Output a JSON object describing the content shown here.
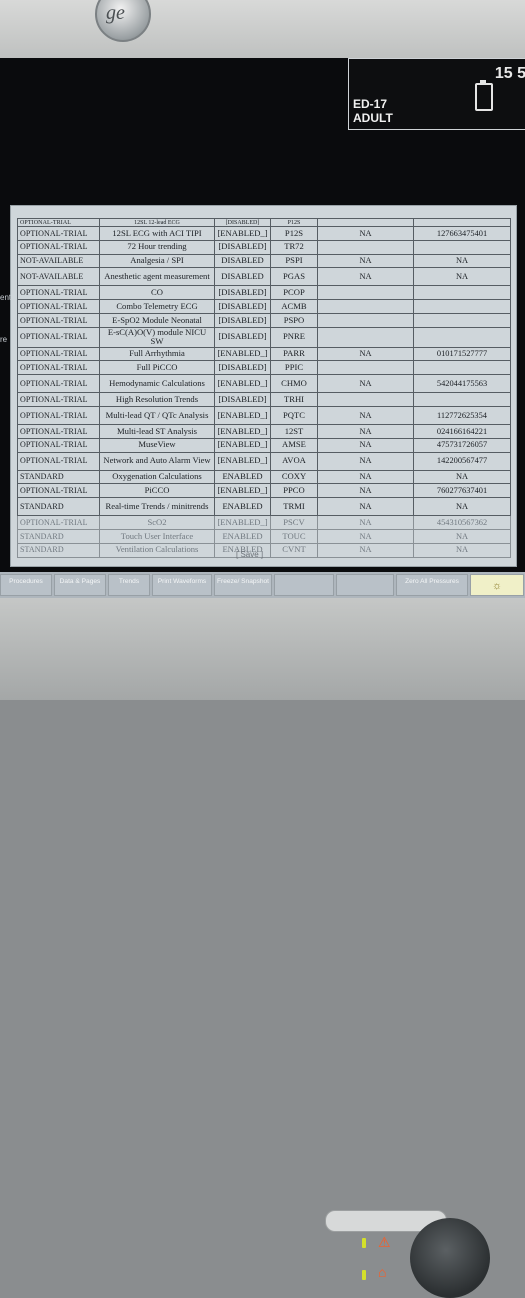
{
  "device": {
    "tile": {
      "number": "15 5",
      "line1": "ED-17",
      "line2": "ADULT"
    }
  },
  "partial_header": {
    "status": "OPTIONAL-TRIAL",
    "option": "12SL 12-lead ECG",
    "state": "[DISABLED]",
    "code": "P12S"
  },
  "left_fragments": [
    "ent",
    "re"
  ],
  "rows": [
    {
      "status": "OPTIONAL-TRIAL",
      "option": "12SL ECG with ACI TIPI",
      "state": "[ENABLED_]",
      "code": "P12S",
      "lic": "NA",
      "key": "127663475401",
      "tall": false,
      "faded": false
    },
    {
      "status": "OPTIONAL-TRIAL",
      "option": "72 Hour trending",
      "state": "[DISABLED]",
      "code": "TR72",
      "lic": "",
      "key": "",
      "tall": false,
      "faded": false
    },
    {
      "status": "NOT-AVAILABLE",
      "option": "Analgesia / SPI",
      "state": "DISABLED",
      "code": "PSPI",
      "lic": "NA",
      "key": "NA",
      "tall": false,
      "faded": false
    },
    {
      "status": "NOT-AVAILABLE",
      "option": "Anesthetic agent measurement",
      "state": "DISABLED",
      "code": "PGAS",
      "lic": "NA",
      "key": "NA",
      "tall": true,
      "faded": false
    },
    {
      "status": "OPTIONAL-TRIAL",
      "option": "CO",
      "state": "[DISABLED]",
      "code": "PCOP",
      "lic": "",
      "key": "",
      "tall": false,
      "faded": false
    },
    {
      "status": "OPTIONAL-TRIAL",
      "option": "Combo Telemetry ECG",
      "state": "[DISABLED]",
      "code": "ACMB",
      "lic": "",
      "key": "",
      "tall": false,
      "faded": false
    },
    {
      "status": "OPTIONAL-TRIAL",
      "option": "E-SpO2 Module Neonatal",
      "state": "[DISABLED]",
      "code": "PSPO",
      "lic": "",
      "key": "",
      "tall": false,
      "faded": false
    },
    {
      "status": "OPTIONAL-TRIAL",
      "option": "E-sC(A)O(V) module NICU SW",
      "state": "[DISABLED]",
      "code": "PNRE",
      "lic": "",
      "key": "",
      "tall": true,
      "faded": false
    },
    {
      "status": "OPTIONAL-TRIAL",
      "option": "Full Arrhythmia",
      "state": "[ENABLED_]",
      "code": "PARR",
      "lic": "NA",
      "key": "010171527777",
      "tall": false,
      "faded": false
    },
    {
      "status": "OPTIONAL-TRIAL",
      "option": "Full PiCCO",
      "state": "[DISABLED]",
      "code": "PPIC",
      "lic": "",
      "key": "",
      "tall": false,
      "faded": false
    },
    {
      "status": "OPTIONAL-TRIAL",
      "option": "Hemodynamic Calculations",
      "state": "[ENABLED_]",
      "code": "CHMO",
      "lic": "NA",
      "key": "542044175563",
      "tall": true,
      "faded": false
    },
    {
      "status": "OPTIONAL-TRIAL",
      "option": "High Resolution Trends",
      "state": "[DISABLED]",
      "code": "TRHI",
      "lic": "",
      "key": "",
      "tall": false,
      "faded": false
    },
    {
      "status": "OPTIONAL-TRIAL",
      "option": "Multi-lead QT / QTc Analysis",
      "state": "[ENABLED_]",
      "code": "PQTC",
      "lic": "NA",
      "key": "112772625354",
      "tall": true,
      "faded": false
    },
    {
      "status": "OPTIONAL-TRIAL",
      "option": "Multi-lead ST Analysis",
      "state": "[ENABLED_]",
      "code": "12ST",
      "lic": "NA",
      "key": "024166164221",
      "tall": false,
      "faded": false
    },
    {
      "status": "OPTIONAL-TRIAL",
      "option": "MuseView",
      "state": "[ENABLED_]",
      "code": "AMSE",
      "lic": "NA",
      "key": "475731726057",
      "tall": false,
      "faded": false
    },
    {
      "status": "OPTIONAL-TRIAL",
      "option": "Network and Auto Alarm View",
      "state": "[ENABLED_]",
      "code": "AVOA",
      "lic": "NA",
      "key": "142200567477",
      "tall": true,
      "faded": false
    },
    {
      "status": "STANDARD",
      "option": "Oxygenation Calculations",
      "state": "ENABLED",
      "code": "COXY",
      "lic": "NA",
      "key": "NA",
      "tall": false,
      "faded": false
    },
    {
      "status": "OPTIONAL-TRIAL",
      "option": "PiCCO",
      "state": "[ENABLED_]",
      "code": "PPCO",
      "lic": "NA",
      "key": "760277637401",
      "tall": false,
      "faded": false
    },
    {
      "status": "STANDARD",
      "option": "Real-time Trends / minitrends",
      "state": "ENABLED",
      "code": "TRMI",
      "lic": "NA",
      "key": "NA",
      "tall": true,
      "faded": false
    },
    {
      "status": "OPTIONAL-TRIAL",
      "option": "ScO2",
      "state": "[ENABLED_]",
      "code": "PSCV",
      "lic": "NA",
      "key": "454310567362",
      "tall": false,
      "faded": true
    },
    {
      "status": "STANDARD",
      "option": "Touch User Interface",
      "state": "ENABLED",
      "code": "TOUC",
      "lic": "NA",
      "key": "NA",
      "tall": false,
      "faded": true
    },
    {
      "status": "STANDARD",
      "option": "Ventilation Calculations",
      "state": "ENABLED",
      "code": "CVNT",
      "lic": "NA",
      "key": "NA",
      "tall": false,
      "faded": true
    }
  ],
  "save_label": "[ Save ]",
  "softkeys": [
    {
      "label": "Procedures"
    },
    {
      "label": "Data & Pages"
    },
    {
      "label": "Trends"
    },
    {
      "label": "Print Waveforms"
    },
    {
      "label": "Freeze/ Snapshot"
    },
    {
      "label": ""
    },
    {
      "label": ""
    },
    {
      "label": "Zero All Pressures"
    },
    {
      "label": "☼"
    }
  ]
}
